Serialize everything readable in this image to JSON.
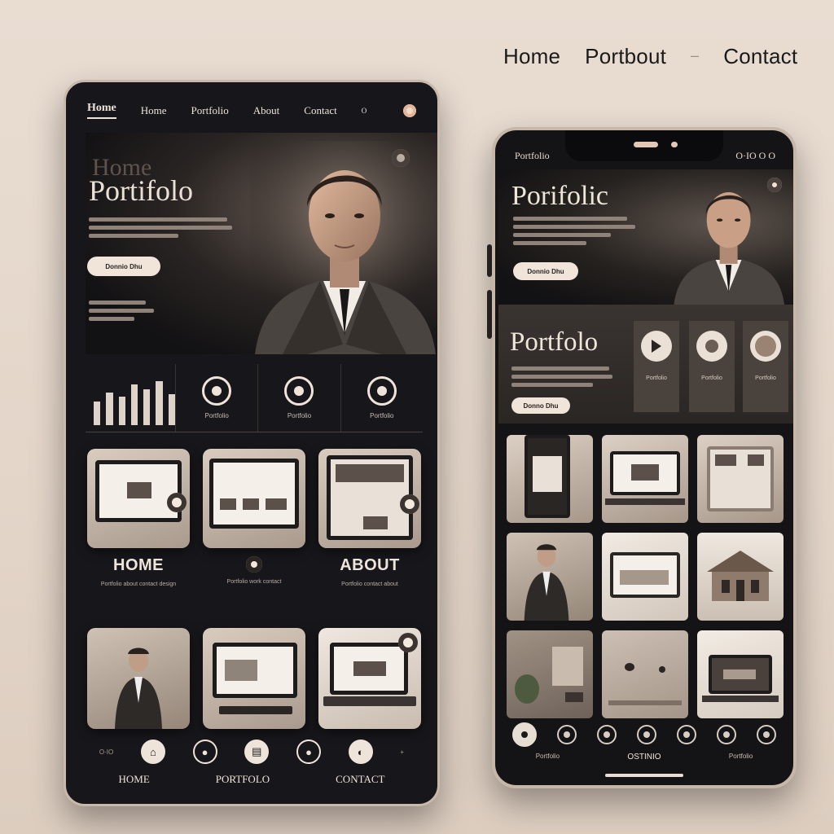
{
  "top_nav": {
    "items": [
      "Home",
      "Portbout",
      "Contact"
    ],
    "separator": "–"
  },
  "tablet": {
    "nav": {
      "active": "Home",
      "items": [
        "Home",
        "Portfolio",
        "About",
        "Contact",
        "O"
      ]
    },
    "hero": {
      "ghost_title": "Home",
      "title": "Portifolo",
      "button": "Donnio Dhu"
    },
    "stats": {
      "bar_levels": [
        0.45,
        0.62,
        0.55,
        0.78,
        0.68,
        0.85,
        0.6
      ],
      "labels": [
        "Portfolio",
        "Portfolio",
        "Portfolio"
      ]
    },
    "sections": {
      "left_title": "HOME",
      "right_title": "ABOUT",
      "left_text": "Portfolio about contact design",
      "mid_text": "Portfolio work contact",
      "right_text": "Portfolio contact about"
    },
    "bottom": {
      "side_left": "O·IO",
      "side_right": "+",
      "labels": [
        "HOME",
        "PORTFOLO",
        "CONTACT"
      ]
    }
  },
  "phone": {
    "status": {
      "left": "Portfolio",
      "right": "O·IO  O  O"
    },
    "hero": {
      "title": "Porifolic",
      "button": "Donnio Dhu"
    },
    "feature": {
      "title": "Portfolo",
      "button": "Donno Dhu",
      "cards": [
        "Portfolio",
        "Portfolio",
        "Portfolio"
      ]
    },
    "dock": {
      "active_label": "OSTINIO",
      "labels": [
        "Portfolio",
        "OSTINIO",
        "Portfolio"
      ]
    }
  }
}
